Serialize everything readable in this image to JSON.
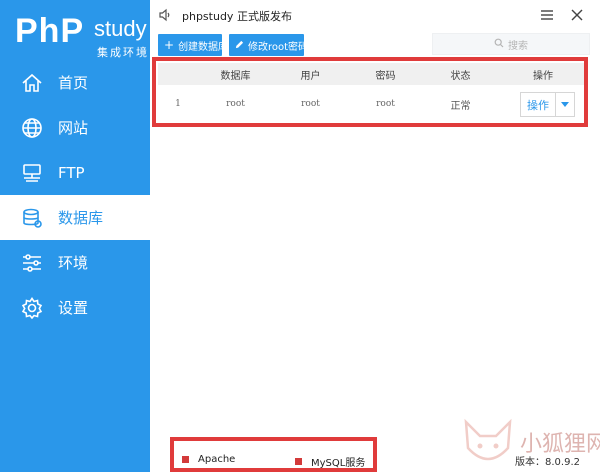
{
  "app": {
    "logo_main": "PhP",
    "logo_study": "study",
    "logo_sub": "集成环境",
    "title": "phpstudy 正式版发布"
  },
  "sidebar": {
    "items": [
      {
        "label": "首页",
        "icon": "home-icon",
        "active": false
      },
      {
        "label": "网站",
        "icon": "globe-icon",
        "active": false
      },
      {
        "label": "FTP",
        "icon": "server-icon",
        "active": false
      },
      {
        "label": "数据库",
        "icon": "database-icon",
        "active": true
      },
      {
        "label": "环境",
        "icon": "sliders-icon",
        "active": false
      },
      {
        "label": "设置",
        "icon": "gear-icon",
        "active": false
      }
    ]
  },
  "toolbar": {
    "create_label": "创建数据库",
    "edit_label": "修改root密码",
    "search_placeholder": "搜索"
  },
  "table": {
    "headers": [
      "",
      "数据库",
      "用户",
      "密码",
      "状态",
      "操作"
    ],
    "rows": [
      {
        "id": "1",
        "database": "root",
        "user": "root",
        "password": "root",
        "status": "正常",
        "action": "操作"
      }
    ]
  },
  "status_bar": {
    "services": [
      {
        "name": "Apache",
        "state_color": "#d33a3a"
      },
      {
        "name": "MySQL服务",
        "state_color": "#d33a3a"
      }
    ],
    "version": "版本：8.0.9.2"
  },
  "watermark": {
    "text": "小狐狸网"
  },
  "colors": {
    "accent": "#2a97ea",
    "highlight_border": "#e03b3b"
  }
}
